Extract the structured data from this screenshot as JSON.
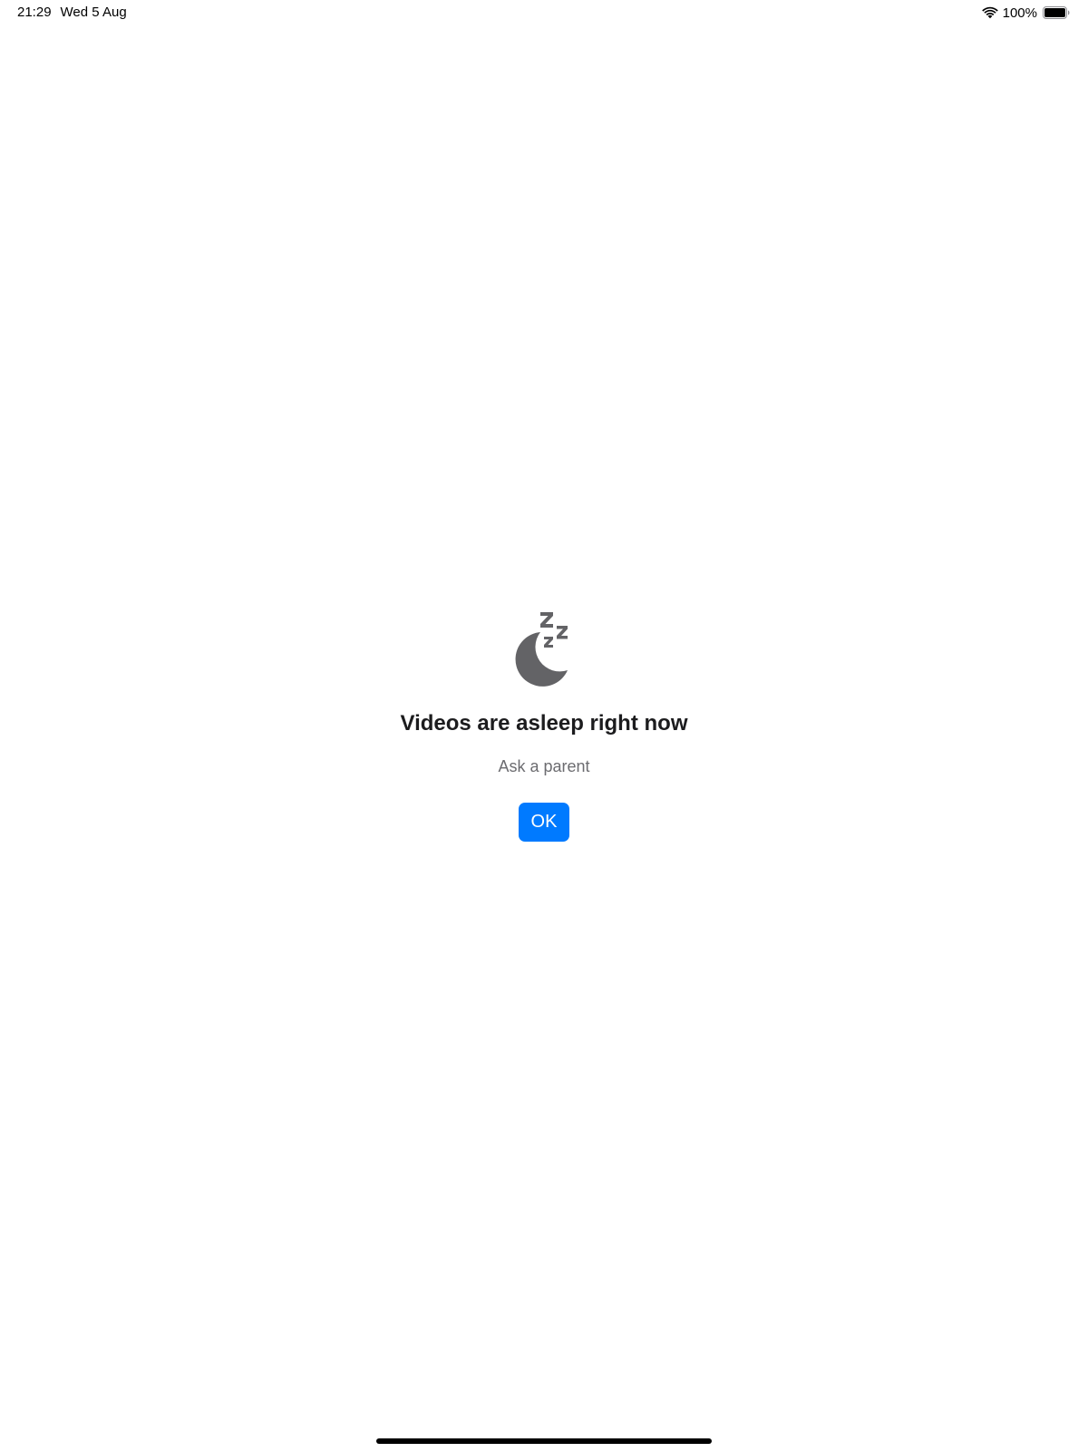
{
  "status_bar": {
    "time": "21:29",
    "date": "Wed 5 Aug",
    "battery_percent": "100%",
    "battery_level": 1.0,
    "icons": [
      "wifi-icon",
      "battery-icon"
    ]
  },
  "main": {
    "icon": "moon-zzz-icon",
    "title": "Videos are asleep right now",
    "subtitle": "Ask a parent",
    "ok_label": "OK"
  },
  "colors": {
    "accent": "#007aff",
    "icon_gray": "#636366",
    "subtitle_gray": "#6c6c70",
    "title": "#1c1c1e"
  }
}
